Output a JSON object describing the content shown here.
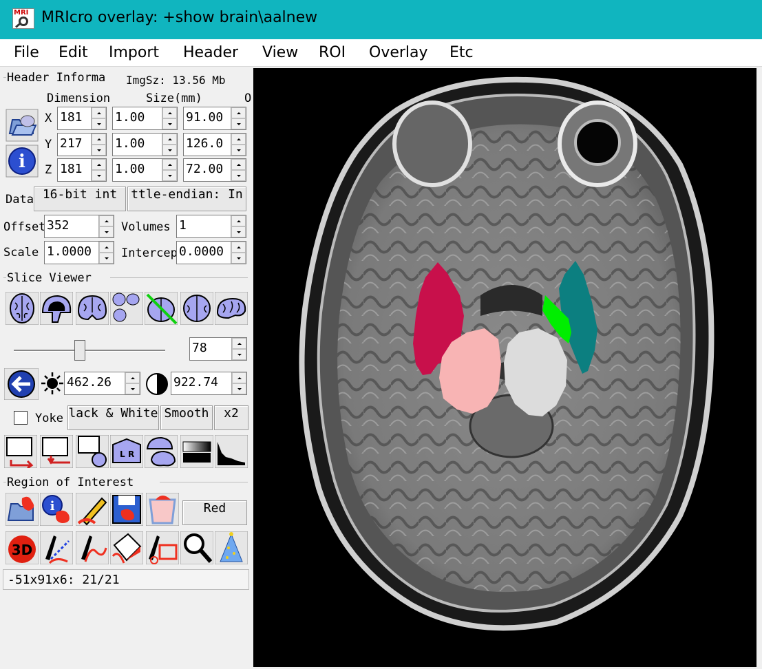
{
  "window": {
    "title": "MRIcro overlay: +show brain\\aalnew",
    "icon_text": "MRI"
  },
  "menu": [
    "File",
    "Edit",
    "Import",
    "Header",
    "View",
    "ROI",
    "Overlay",
    "Etc"
  ],
  "header_info": {
    "group_label": "Header Informa",
    "img_size": "ImgSz: 13.56 Mb",
    "col_dimension": "Dimension",
    "col_size": "Size(mm)",
    "col_origin": "O",
    "rows": [
      {
        "axis": "X",
        "dim": "181",
        "size": "1.00",
        "origin": "91.00"
      },
      {
        "axis": "Y",
        "dim": "217",
        "size": "1.00",
        "origin": "126.0"
      },
      {
        "axis": "Z",
        "dim": "181",
        "size": "1.00",
        "origin": "72.00"
      }
    ],
    "data_label": "Data",
    "datatype": "16-bit int",
    "endian": "ttle-endian: In",
    "offset_label": "Offset",
    "offset_value": "352",
    "volumes_label": "Volumes",
    "volumes_value": "1",
    "scale_label": "Scale",
    "scale_value": "1.0000",
    "intercept_label": "Intercept",
    "intercept_value": "0.0000"
  },
  "slice_viewer": {
    "group_label": "Slice Viewer",
    "slice_value": "78",
    "brightness": "462.26",
    "contrast": "922.74",
    "yoke_label": "Yoke",
    "colormap": "lack & White",
    "smooth": "Smooth",
    "zoom": "x2"
  },
  "roi": {
    "group_label": "Region of Interest",
    "color_button": "Red"
  },
  "status": "-51x91x6: 21/21",
  "icons": {
    "header_row": [
      "open-folder-icon",
      "info-icon"
    ],
    "slice_views": [
      "axial-brain-icon",
      "sagittal-brain-icon",
      "coronal-brain-icon",
      "multi-slice-icon",
      "oblique-slice-icon",
      "mosaic-icon",
      "render-brain-icon"
    ],
    "view_tools": [
      "reset-contrast-icon",
      "brightness-sun-icon",
      "contrast-icon"
    ],
    "display_tools": [
      "overlay-icon",
      "flip-icon",
      "roi-dot-icon",
      "lr-flip-icon",
      "brain-overlay-icon",
      "gradient-icon",
      "histogram-icon"
    ],
    "roi_tools": [
      "open-roi-icon",
      "roi-info-icon",
      "pencil-icon",
      "save-roi-icon",
      "roi-mask-icon"
    ],
    "draw_tools": [
      "render-3d-icon",
      "dotted-pen-icon",
      "freehand-pen-icon",
      "fill-bucket-icon",
      "erase-rect-icon",
      "magnify-icon",
      "party-hat-icon"
    ]
  },
  "colors": {
    "titlebar": "#10b5bf",
    "overlay_left_temporal": "#c8104b",
    "overlay_right_temporal": "#0c7f80",
    "overlay_green": "#00ee00",
    "overlay_left_hippo": "#f8b4b4",
    "overlay_right_hippo": "#dcdcdc"
  }
}
